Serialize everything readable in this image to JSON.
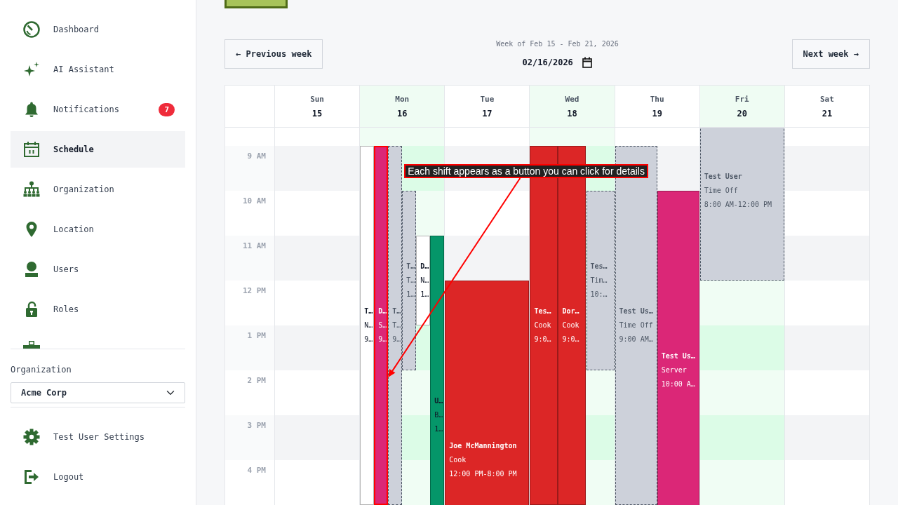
{
  "sidebar": {
    "nav_items": [
      {
        "label": "Dashboard",
        "selected": false
      },
      {
        "label": "AI Assistant",
        "selected": false
      },
      {
        "label": "Notifications",
        "selected": false,
        "badge": "7"
      },
      {
        "label": "Schedule",
        "selected": true
      },
      {
        "label": "Organization",
        "selected": false
      },
      {
        "label": "Location",
        "selected": false
      },
      {
        "label": "Users",
        "selected": false
      },
      {
        "label": "Roles",
        "selected": false
      }
    ],
    "more_items_below": true,
    "organization": {
      "label": "Organization",
      "value": "Acme Corp"
    },
    "footer_items": [
      {
        "label": "Test User Settings"
      },
      {
        "label": "Logout"
      }
    ]
  },
  "week_nav": {
    "previous_button": "← Previous week",
    "range_label": "Week of Feb 15 - Feb 21, 2026",
    "date_value": "02/16/2026",
    "next_button": "Next week →"
  },
  "calendar": {
    "hours": [
      "9 AM",
      "10 AM",
      "11 AM",
      "12 PM",
      "1 PM",
      "2 PM",
      "3 PM",
      "4 PM"
    ],
    "days": [
      {
        "name": "Sun",
        "date": "15",
        "highlighted": false
      },
      {
        "name": "Mon",
        "date": "16",
        "highlighted": true,
        "events": [
          {
            "kind": "shift",
            "color": "#ffffff",
            "name": "T…",
            "label": "N…",
            "time": "9…",
            "highlighted": false
          },
          {
            "kind": "shift",
            "color": "#db2777",
            "name": "D…",
            "label": "S…",
            "time": "9…",
            "highlighted": true
          },
          {
            "kind": "time_off",
            "name": "T…",
            "label": "T…",
            "time": "9…",
            "highlighted": false
          },
          {
            "kind": "time_off",
            "name": "T…",
            "label": "T…",
            "time": "1…",
            "highlighted": false
          },
          {
            "kind": "shift",
            "color": "#ffffff",
            "name": "D…",
            "label": "N…",
            "time": "1…",
            "highlighted": false
          },
          {
            "kind": "shift",
            "color": "#059669",
            "name": "U…",
            "label": "B…",
            "time": "1…",
            "highlighted": false
          }
        ]
      },
      {
        "name": "Tue",
        "date": "17",
        "highlighted": false,
        "events": [
          {
            "kind": "shift",
            "color": "#dc2626",
            "name": "Joe McMannington",
            "label": "Cook",
            "time": "12:00 PM-8:00 PM",
            "highlighted": false
          }
        ]
      },
      {
        "name": "Wed",
        "date": "18",
        "highlighted": true,
        "events": [
          {
            "kind": "shift",
            "color": "#dc2626",
            "name": "Tes…",
            "label": "Cook",
            "time": "9:0…",
            "highlighted": false
          },
          {
            "kind": "shift",
            "color": "#dc2626",
            "name": "Dor…",
            "label": "Cook",
            "time": "9:0…",
            "highlighted": false
          },
          {
            "kind": "time_off",
            "name": "Tes…",
            "label": "Tim…",
            "time": "10:…",
            "highlighted": false
          }
        ]
      },
      {
        "name": "Thu",
        "date": "19",
        "highlighted": false,
        "events": [
          {
            "kind": "time_off",
            "name": "Test Us…",
            "label": "Time Off",
            "time": "9:00 AM…",
            "highlighted": false
          },
          {
            "kind": "shift",
            "color": "#db2777",
            "name": "Test Us…",
            "label": "Server",
            "time": "10:00 A…",
            "highlighted": false
          }
        ]
      },
      {
        "name": "Fri",
        "date": "20",
        "highlighted": true,
        "events": [
          {
            "kind": "time_off",
            "name": "Test User",
            "label": "Time Off",
            "time": "8:00 AM-12:00 PM",
            "highlighted": false
          }
        ]
      },
      {
        "name": "Sat",
        "date": "21",
        "highlighted": false
      }
    ]
  },
  "annotation": {
    "text": "Each shift appears as a button you can click for details"
  }
}
